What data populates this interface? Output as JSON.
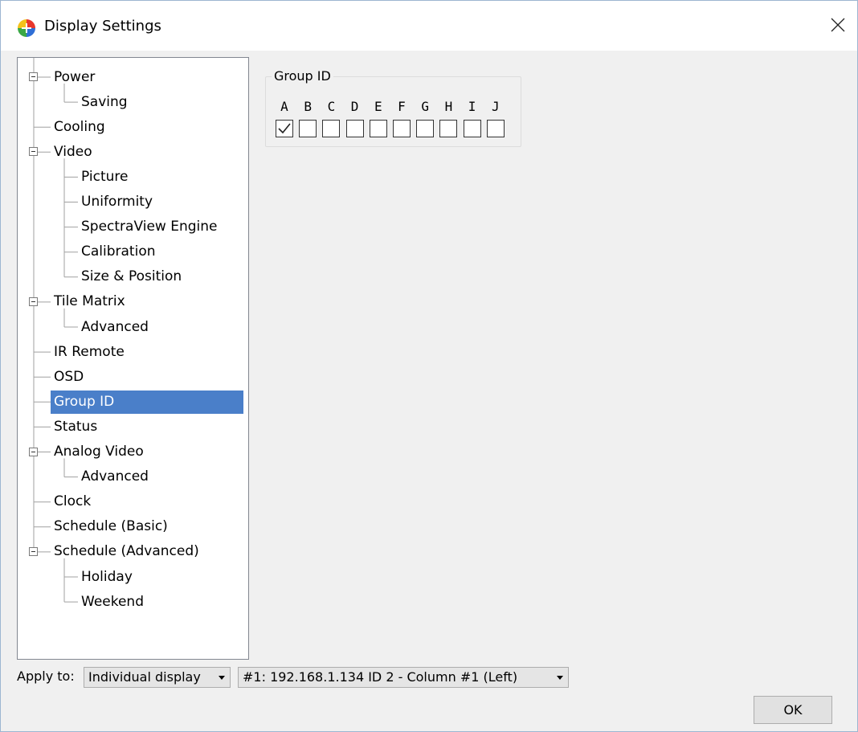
{
  "window": {
    "title": "Display Settings",
    "icon": "nec-color-wheel-icon",
    "close_icon": "close-icon",
    "accent_color": "#4a7fc9"
  },
  "tree": {
    "items": [
      {
        "label": "Power",
        "level": 0,
        "expanded": true
      },
      {
        "label": "Saving",
        "level": 1
      },
      {
        "label": "Cooling",
        "level": 0
      },
      {
        "label": "Video",
        "level": 0,
        "expanded": true
      },
      {
        "label": "Picture",
        "level": 1
      },
      {
        "label": "Uniformity",
        "level": 1
      },
      {
        "label": "SpectraView Engine",
        "level": 1
      },
      {
        "label": "Calibration",
        "level": 1
      },
      {
        "label": "Size & Position",
        "level": 1
      },
      {
        "label": "Tile Matrix",
        "level": 0,
        "expanded": true
      },
      {
        "label": "Advanced",
        "level": 1
      },
      {
        "label": "IR Remote",
        "level": 0
      },
      {
        "label": "OSD",
        "level": 0
      },
      {
        "label": "Group ID",
        "level": 0,
        "selected": true
      },
      {
        "label": "Status",
        "level": 0
      },
      {
        "label": "Analog Video",
        "level": 0,
        "expanded": true
      },
      {
        "label": "Advanced",
        "level": 1
      },
      {
        "label": "Clock",
        "level": 0
      },
      {
        "label": "Schedule (Basic)",
        "level": 0
      },
      {
        "label": "Schedule (Advanced)",
        "level": 0,
        "expanded": true
      },
      {
        "label": "Holiday",
        "level": 1
      },
      {
        "label": "Weekend",
        "level": 1
      }
    ]
  },
  "group_id": {
    "legend": "Group ID",
    "columns": [
      {
        "letter": "A",
        "checked": true
      },
      {
        "letter": "B",
        "checked": false
      },
      {
        "letter": "C",
        "checked": false
      },
      {
        "letter": "D",
        "checked": false
      },
      {
        "letter": "E",
        "checked": false
      },
      {
        "letter": "F",
        "checked": false
      },
      {
        "letter": "G",
        "checked": false
      },
      {
        "letter": "H",
        "checked": false
      },
      {
        "letter": "I",
        "checked": false
      },
      {
        "letter": "J",
        "checked": false
      }
    ]
  },
  "footer": {
    "apply_label": "Apply to:",
    "apply_value": "Individual display",
    "display_value": "#1: 192.168.1.134 ID 2 - Column #1 (Left)",
    "ok_label": "OK"
  }
}
